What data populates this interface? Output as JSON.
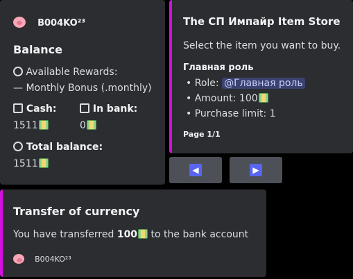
{
  "balance_card": {
    "author_name": "B004KO²³",
    "title": "Balance",
    "rewards_label": "Available Rewards:",
    "rewards_item": "— Monthly Bonus (.monthly)",
    "cash_label": "Cash:",
    "cash_value": "1511",
    "bank_label": "In bank:",
    "bank_value": "0",
    "total_label": "Total balance:",
    "total_value": "1511"
  },
  "store_card": {
    "title": "The СП Импайр Item Store",
    "description": "Select the item you want to buy.",
    "item_name": "Главная роль",
    "role_label": "Role:",
    "role_mention": "@Главная роль",
    "amount_label": "Amount:",
    "amount_value": "100",
    "limit_label": "Purchase limit:",
    "limit_value": "1",
    "footer": "Page 1/1",
    "accent_color": "#d50fe0"
  },
  "nav": {
    "prev_label": "◀",
    "next_label": "▶"
  },
  "transfer_card": {
    "title": "Transfer of currency",
    "text_before": "You have transferred",
    "amount": "100",
    "text_after": "to the bank account",
    "author_name": "B004KO²³",
    "accent_color": "#d50fe0"
  }
}
